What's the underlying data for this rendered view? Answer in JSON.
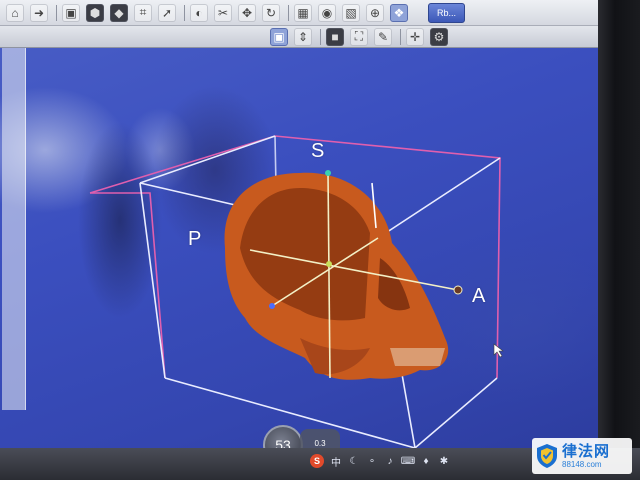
{
  "toolbar": {
    "icons": [
      "home-icon",
      "forward-icon",
      "save-icon",
      "layers-icon",
      "cube-icon",
      "crop-icon",
      "cursor-icon",
      "contrast-icon",
      "scissors-icon",
      "move-icon",
      "rotate-icon",
      "grid-icon",
      "drop-icon",
      "fill-icon",
      "zoom-icon",
      "view-icon"
    ],
    "open_button_label": "Rb..."
  },
  "viewport": {
    "axis_labels": {
      "superior": "S",
      "posterior": "P",
      "anterior": "A"
    },
    "bone_color": "#c85a1e",
    "box_color": "#e9ecff",
    "accent_box_color": "#e05fae"
  },
  "controls": {
    "zoom_value": "53",
    "zoom_detail": "0.3"
  },
  "taskbar": {
    "logo": "S",
    "lang": "中",
    "icons": [
      "moon-icon",
      "dots-icon",
      "mic-icon",
      "keyboard-icon",
      "shirt-icon",
      "tools-icon"
    ]
  },
  "watermark": {
    "title": "律法网",
    "url": "88148.com"
  }
}
